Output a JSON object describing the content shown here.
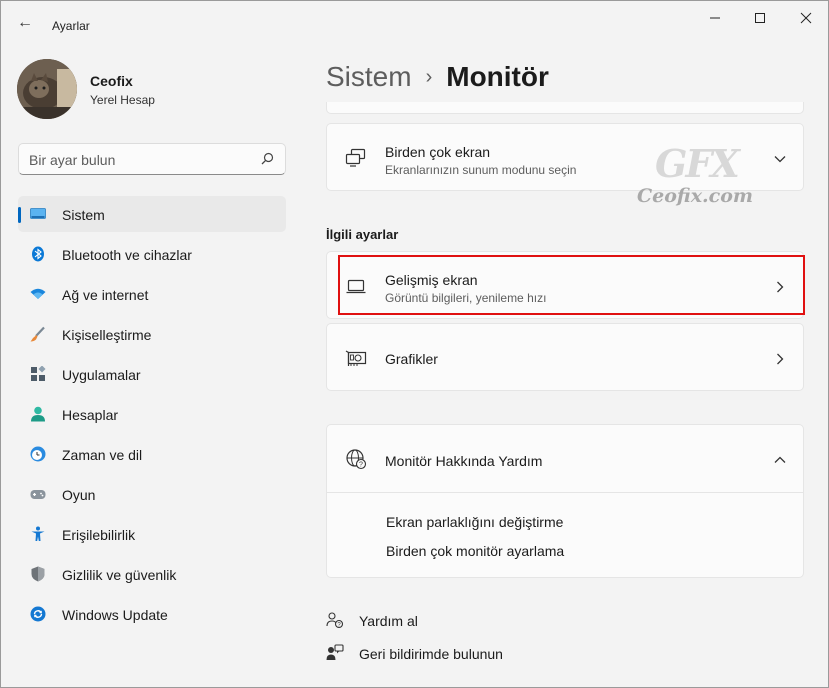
{
  "window": {
    "title": "Ayarlar",
    "back_icon": "←",
    "minimize_icon": "—",
    "maximize_icon": "☐",
    "close_icon": "✕"
  },
  "profile": {
    "name": "Ceofix",
    "account_type": "Yerel Hesap"
  },
  "search": {
    "placeholder": "Bir ayar bulun"
  },
  "sidebar": {
    "items": [
      {
        "label": "Sistem",
        "active": true,
        "icon": "monitor-icon",
        "color": "#0078d4"
      },
      {
        "label": "Bluetooth ve cihazlar",
        "active": false,
        "icon": "bluetooth-icon",
        "color": "#0078d4"
      },
      {
        "label": "Ağ ve internet",
        "active": false,
        "icon": "wifi-icon",
        "color": "#0078d4"
      },
      {
        "label": "Kişiselleştirme",
        "active": false,
        "icon": "brush-icon",
        "color": "#e68a3a"
      },
      {
        "label": "Uygulamalar",
        "active": false,
        "icon": "apps-icon",
        "color": "#4a5a6a"
      },
      {
        "label": "Hesaplar",
        "active": false,
        "icon": "person-icon",
        "color": "#2bb5a0"
      },
      {
        "label": "Zaman ve dil",
        "active": false,
        "icon": "clock-globe-icon",
        "color": "#0078d4"
      },
      {
        "label": "Oyun",
        "active": false,
        "icon": "gamepad-icon",
        "color": "#7a7a7a"
      },
      {
        "label": "Erişilebilirlik",
        "active": false,
        "icon": "accessibility-icon",
        "color": "#0078d4"
      },
      {
        "label": "Gizlilik ve güvenlik",
        "active": false,
        "icon": "shield-icon",
        "color": "#6a6a6a"
      },
      {
        "label": "Windows Update",
        "active": false,
        "icon": "update-icon",
        "color": "#0078d4"
      }
    ]
  },
  "header": {
    "parent": "Sistem",
    "separator": "›",
    "current": "Monitör"
  },
  "multi_display": {
    "title": "Birden çok ekran",
    "description": "Ekranlarınızın sunum modunu seçin"
  },
  "related": {
    "section_title": "İlgili ayarlar",
    "advanced_display": {
      "title": "Gelişmiş ekran",
      "description": "Görüntü bilgileri, yenileme hızı"
    },
    "graphics": {
      "title": "Grafikler"
    }
  },
  "help": {
    "title": "Monitör Hakkında Yardım",
    "links": [
      "Ekran parlaklığını değiştirme",
      "Birden çok monitör ayarlama"
    ]
  },
  "footer": {
    "get_help": "Yardım al",
    "feedback": "Geri bildirimde bulunun"
  },
  "watermark": {
    "logo": "GFX",
    "site": "Ceofix.com"
  },
  "colors": {
    "accent": "#0067c0",
    "highlight_border": "#e01010"
  }
}
